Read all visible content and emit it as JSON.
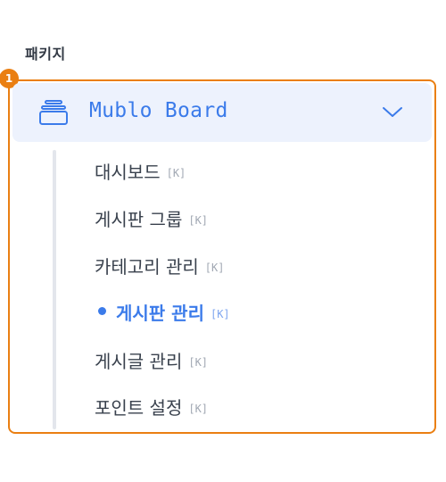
{
  "section": {
    "label": "패키지"
  },
  "annotation": {
    "badge_number": "1",
    "color": "#ea7f12"
  },
  "package": {
    "title": "Mublo Board",
    "icon": "stack-icon",
    "toggle_icon": "chevron-down-icon",
    "expanded": true,
    "accent_color": "#3b7bea",
    "header_bg": "#edf2fd"
  },
  "menu": {
    "items": [
      {
        "label": "대시보드",
        "shortcut": "[K]",
        "active": false
      },
      {
        "label": "게시판 그룹",
        "shortcut": "[K]",
        "active": false
      },
      {
        "label": "카테고리 관리",
        "shortcut": "[K]",
        "active": false
      },
      {
        "label": "게시판 관리",
        "shortcut": "[K]",
        "active": true
      },
      {
        "label": "게시글 관리",
        "shortcut": "[K]",
        "active": false
      },
      {
        "label": "포인트 설정",
        "shortcut": "[K]",
        "active": false
      }
    ]
  }
}
